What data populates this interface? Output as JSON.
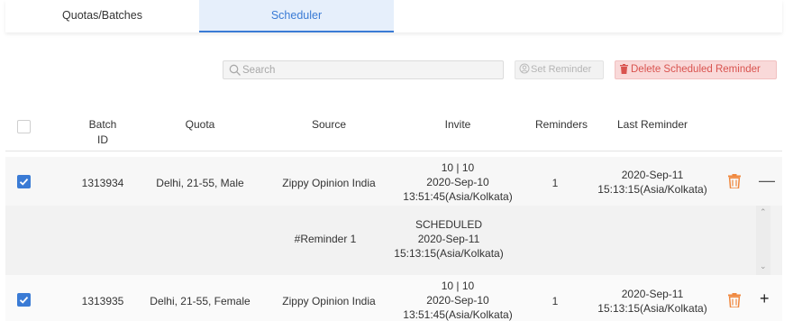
{
  "tabs": [
    {
      "label": "Quotas/Batches",
      "active": false
    },
    {
      "label": "Scheduler",
      "active": true
    }
  ],
  "search": {
    "placeholder": "Search",
    "value": ""
  },
  "toolbar": {
    "set_reminder_label": "Set Reminder",
    "delete_reminder_label": "Delete Scheduled Reminder"
  },
  "table": {
    "headers": {
      "batch_id_1": "Batch",
      "batch_id_2": "ID",
      "quota": "Quota",
      "source": "Source",
      "invite": "Invite",
      "reminders": "Reminders",
      "last_reminder": "Last Reminder"
    },
    "rows": [
      {
        "checked": true,
        "batch_id": "1313934",
        "quota": "Delhi, 21-55, Male",
        "source": "Zippy Opinion India",
        "invite_count": "10 | 10",
        "invite_date": "2020-Sep-10",
        "invite_time": "13:51:45(Asia/Kolkata)",
        "reminders": "1",
        "last_reminder_date": "2020-Sep-11",
        "last_reminder_time": "15:13:15(Asia/Kolkata)",
        "expand_symbol": "—",
        "subrow": {
          "label": "#Reminder 1",
          "status": "SCHEDULED",
          "date": "2020-Sep-11",
          "time": "15:13:15(Asia/Kolkata)"
        }
      },
      {
        "checked": true,
        "batch_id": "1313935",
        "quota": "Delhi, 21-55, Female",
        "source": "Zippy Opinion India",
        "invite_count": "10 | 10",
        "invite_date": "2020-Sep-10",
        "invite_time": "13:51:45(Asia/Kolkata)",
        "reminders": "1",
        "last_reminder_date": "2020-Sep-11",
        "last_reminder_time": "15:13:15(Asia/Kolkata)",
        "expand_symbol": "+"
      }
    ]
  },
  "colors": {
    "accent": "#3a7bd5",
    "danger": "#d9534f",
    "trash": "#f0883e"
  },
  "icons": {
    "search": "search-icon",
    "set_reminder": "user-circle-icon",
    "delete": "trash-icon",
    "checkbox": "checkmark-icon"
  }
}
